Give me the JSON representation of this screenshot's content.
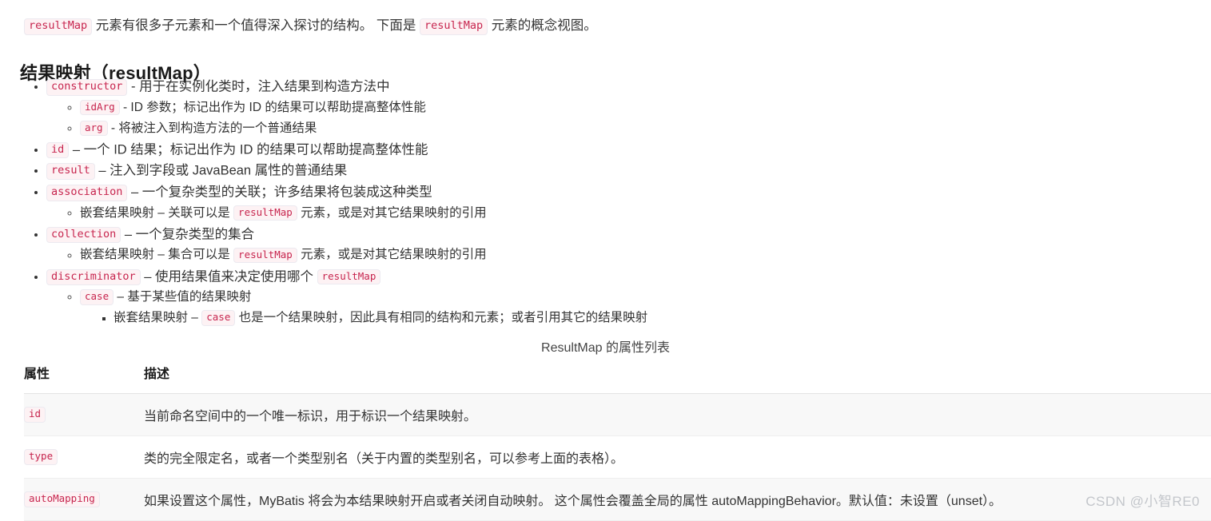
{
  "intro": {
    "part1": "元素有很多子元素和一个值得深入探讨的结构。 下面是",
    "part2": "元素的概念视图。",
    "code1": "resultMap",
    "code2": "resultMap"
  },
  "heading": "结果映射（resultMap）",
  "list": [
    {
      "code": "constructor",
      "text": "- 用于在实例化类时，注入结果到构造方法中",
      "children": [
        {
          "code": "idArg",
          "text": "- ID 参数；标记出作为 ID 的结果可以帮助提高整体性能"
        },
        {
          "code": "arg",
          "text": "- 将被注入到构造方法的一个普通结果"
        }
      ]
    },
    {
      "code": "id",
      "text": "– 一个 ID 结果；标记出作为 ID 的结果可以帮助提高整体性能",
      "children": []
    },
    {
      "code": "result",
      "text": "– 注入到字段或 JavaBean 属性的普通结果",
      "children": []
    },
    {
      "code": "association",
      "text": "– 一个复杂类型的关联；许多结果将包装成这种类型",
      "children": [
        {
          "pre": "嵌套结果映射 – 关联可以是",
          "code": "resultMap",
          "post": "元素，或是对其它结果映射的引用"
        }
      ]
    },
    {
      "code": "collection",
      "text": "– 一个复杂类型的集合",
      "children": [
        {
          "pre": "嵌套结果映射 – 集合可以是",
          "code": "resultMap",
          "post": "元素，或是对其它结果映射的引用"
        }
      ]
    },
    {
      "code": "discriminator",
      "pre_text": "– 使用结果值来决定使用哪个",
      "trailing_code": "resultMap",
      "children": [
        {
          "code": "case",
          "text": "– 基于某些值的结果映射",
          "grandchildren": [
            {
              "pre": "嵌套结果映射 –",
              "code": "case",
              "post": "也是一个结果映射，因此具有相同的结构和元素；或者引用其它的结果映射"
            }
          ]
        }
      ]
    }
  ],
  "table": {
    "caption": "ResultMap 的属性列表",
    "headers": [
      "属性",
      "描述"
    ],
    "rows": [
      {
        "attr": "id",
        "desc": "当前命名空间中的一个唯一标识，用于标识一个结果映射。"
      },
      {
        "attr": "type",
        "desc": "类的完全限定名，或者一个类型别名（关于内置的类型别名，可以参考上面的表格）。"
      },
      {
        "attr": "autoMapping",
        "desc": "如果设置这个属性，MyBatis 将会为本结果映射开启或者关闭自动映射。 这个属性会覆盖全局的属性 autoMappingBehavior。默认值：未设置（unset）。"
      }
    ]
  },
  "watermark": "CSDN @小智RE0",
  "colors": {
    "code_text": "#c7254e",
    "code_bg": "#fdf2f4",
    "code_border": "#eceaf0",
    "body_text": "#333333",
    "heading_text": "#1a1a1a",
    "row_stripe": "#f8f8f8",
    "watermark": "#c3c6cb"
  }
}
